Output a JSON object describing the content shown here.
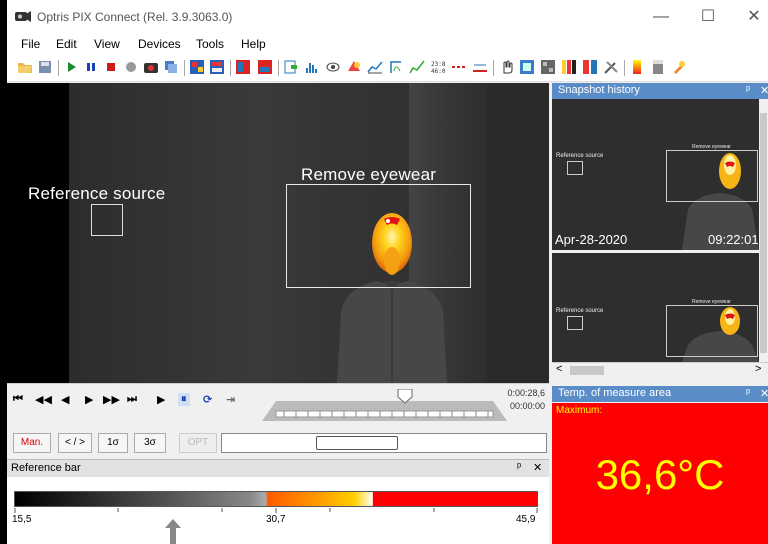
{
  "window": {
    "title": "Optris PIX Connect (Rel. 3.9.3063.0)",
    "minimize_glyph": "—",
    "maximize_glyph": "☐",
    "close_glyph": "✕"
  },
  "menu": [
    "File",
    "Edit",
    "View",
    "Devices",
    "Tools",
    "Help"
  ],
  "video": {
    "reference_label": "Reference source",
    "eyewear_label": "Remove eyewear"
  },
  "playback": {
    "buttons": [
      "⏮",
      "◀◀",
      "◀",
      "▶",
      "▶▶",
      "⏭",
      "▶",
      "⏸",
      "⟳",
      "⇥"
    ],
    "time_total": "0:00:28,6",
    "time_current": "00:00:00"
  },
  "scale_controls": {
    "man": "Man.",
    "range": "< / >",
    "sigma1": "1σ",
    "sigma3": "3σ",
    "opt": "OPT"
  },
  "reference_bar": {
    "title": "Reference bar",
    "pin": "ᵖ",
    "close": "✕",
    "min_label": "15,5",
    "mid_label": "30,7",
    "max_label": "45,9"
  },
  "snapshot_history": {
    "title": "Snapshot history",
    "pin": "ᵖ",
    "close": "✕",
    "items": [
      {
        "date": "Apr-28-2020",
        "time": "09:22:01",
        "ref_label": "Reference source",
        "ew_label": "Remove eyewear"
      },
      {
        "date": "",
        "time": "",
        "ref_label": "Reference source",
        "ew_label": "Remove eyewear"
      }
    ],
    "scroll_left": "<",
    "scroll_right": ">"
  },
  "measure_area": {
    "title": "Temp. of measure area",
    "pin": "ᵖ",
    "close": "✕",
    "label": "Maximum:",
    "value": "36,6°C"
  },
  "colors": {
    "panel_header": "#5a8dc8",
    "alarm_bg": "#ff0000",
    "alarm_text": "#ffff00"
  }
}
